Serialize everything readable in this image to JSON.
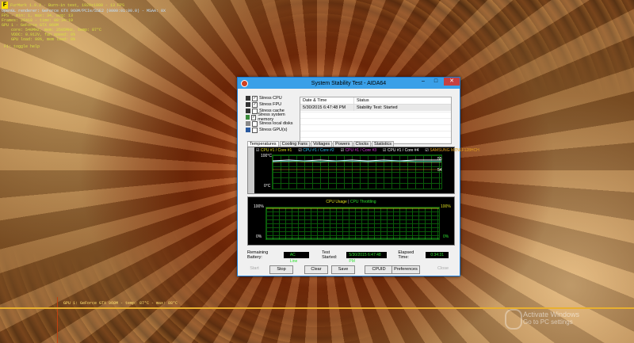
{
  "osd": {
    "app": "FurMark 1.9.2 - Burn-in test, 1920x1080 - 13 FPS",
    "lines": [
      "OpenGL renderer: GeForce GTX 960M/PCIe/SSE2 (0000:01:00.0) - MSAA: 0X",
      "FPS - min: 1, max: 34, avg: 13",
      "Frames: 26418 - time: 00:34:19",
      "GPU 1 - GeForce GTX 960M",
      "core: 540MHz, mem: 2505MHz, temp: 87°C",
      "VDDC: 0.912V, fan speed: 0%",
      "GPU load: 99%, mem load: 9%",
      "F1: toggle help"
    ],
    "gpu_graph_label": "GPU 1: GeForce GTX 960M - temp: 87°C - max: 88°C"
  },
  "desktop": {
    "activate_title": "Activate Windows",
    "activate_sub": "Go to PC settings"
  },
  "window": {
    "title": "System Stability Test - AIDA64",
    "min": "–",
    "max": "□",
    "close": "✕",
    "options": [
      {
        "label": "Stress CPU",
        "checked": "✓"
      },
      {
        "label": "Stress FPU",
        "checked": "✓"
      },
      {
        "label": "Stress cache",
        "checked": ""
      },
      {
        "label": "Stress system memory",
        "checked": "✓"
      },
      {
        "label": "Stress local disks",
        "checked": ""
      },
      {
        "label": "Stress GPU(s)",
        "checked": ""
      }
    ],
    "log": {
      "col_date": "Date & Time",
      "col_status": "Status",
      "date": "5/30/2015 6:47:48 PM",
      "status": "Stability Test: Started"
    },
    "tabs": [
      "Temperatures",
      "Cooling Fans",
      "Voltages",
      "Powers",
      "Clocks",
      "Statistics"
    ],
    "temp_legend": [
      {
        "label": "CPU #1 / Core #1",
        "color": "#e0e020"
      },
      {
        "label": "CPU #1 / Core #2",
        "color": "#30c0f0"
      },
      {
        "label": "CPU #1 / Core #3",
        "color": "#e040e0"
      },
      {
        "label": "CPU #1 / Core #4",
        "color": "#ffffff"
      },
      {
        "label": "SAMSUNG MZNLF128HCH",
        "color": "#e0a020"
      }
    ],
    "temp_y_top": "100°C",
    "temp_y_bottom": "0°C",
    "temp_right_a": "55",
    "temp_right_b": "54",
    "usage_title_a": "CPU Usage",
    "usage_title_sep": "|",
    "usage_title_b": "CPU Throttling",
    "usage_left_top": "100%",
    "usage_left_bottom": "0%",
    "usage_right_top": "100%",
    "usage_right_bottom": "0%",
    "battery_label": "Remaining Battery:",
    "battery_value": "AC Line",
    "started_label": "Test Started:",
    "started_value": "5/30/2015 6:47:48 PM",
    "elapsed_label": "Elapsed Time:",
    "elapsed_value": "0:34:31",
    "buttons": {
      "start": "Start",
      "stop": "Stop",
      "clear": "Clear",
      "save": "Save",
      "cpuid": "CPUID",
      "preferences": "Preferences",
      "close": "Close"
    }
  }
}
